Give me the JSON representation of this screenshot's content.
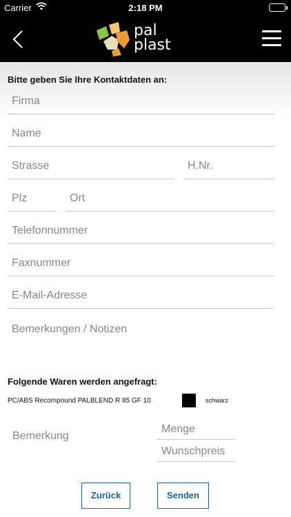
{
  "status_bar": {
    "carrier": "Carrier",
    "time": "2:18 PM"
  },
  "nav": {
    "logo_line1": "pal",
    "logo_line2": "plast"
  },
  "contact": {
    "title": "Bitte geben Sie Ihre Kontaktdaten an:",
    "company_placeholder": "Firma",
    "name_placeholder": "Name",
    "street_placeholder": "Strasse",
    "house_number_placeholder": "H.Nr.",
    "zip_placeholder": "Plz",
    "city_placeholder": "Ort",
    "phone_placeholder": "Telefonnummer",
    "fax_placeholder": "Faxnummer",
    "email_placeholder": "E-Mail-Adresse",
    "notes_placeholder": "Bemerkungen / Notizen"
  },
  "goods": {
    "title": "Folgende Waren werden angefragt:",
    "product": "PC/ABS Recompound PALBLEND R 85 GF 10",
    "color_name": "schwarz",
    "color_hex": "#000000",
    "remark_placeholder": "Bemerkung",
    "quantity_placeholder": "Menge",
    "desired_price_placeholder": "Wunschpreis"
  },
  "actions": {
    "back_label": "Zurück",
    "send_label": "Senden"
  },
  "colors": {
    "accent": "#1f5fa8",
    "logo_green": "#8cc63f",
    "logo_orange": "#f39c34",
    "logo_yellow": "#f7c96b",
    "logo_light": "#e9dfb8"
  }
}
